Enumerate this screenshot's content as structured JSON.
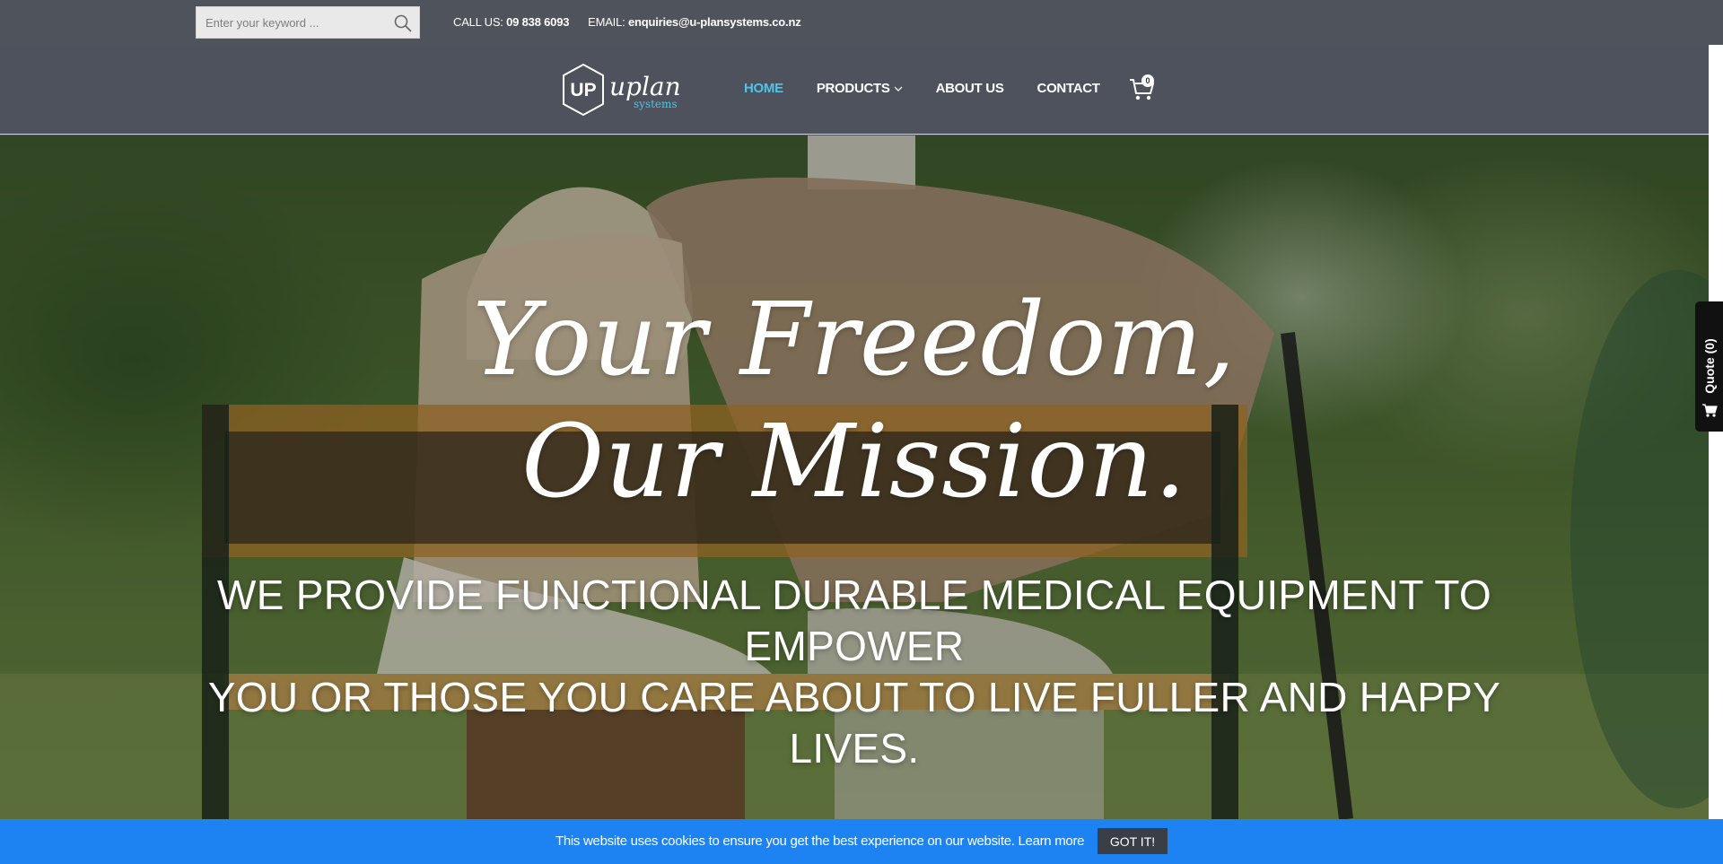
{
  "topbar": {
    "search_placeholder": "Enter your keyword ...",
    "call_label": "CALL US:",
    "phone": "09 838 6093",
    "email_label": "EMAIL:",
    "email": "enquiries@u-plansystems.co.nz"
  },
  "logo": {
    "mark": "UP",
    "name": "uplan",
    "tagline": "systems"
  },
  "nav": {
    "items": [
      {
        "label": "HOME",
        "active": true
      },
      {
        "label": "PRODUCTS",
        "has_dropdown": true
      },
      {
        "label": "ABOUT US"
      },
      {
        "label": "CONTACT"
      }
    ],
    "cart_count": "0"
  },
  "hero": {
    "title_line1": "Your Freedom,",
    "title_line2": "Our Mission.",
    "subtitle_line1": "We provide functional durable medical equipment to empower",
    "subtitle_line2": "you or those you care about to live fuller and happy lives."
  },
  "quote_tab": {
    "label": "Quote (0)"
  },
  "cookie": {
    "text": "This website uses cookies to ensure you get the best experience on our website.",
    "link": "Learn more",
    "button": "GOT IT!"
  },
  "colors": {
    "accent": "#4fc4e8",
    "header_bg": "#4d525c",
    "cookie_bg": "#1e83f2",
    "button_bg": "#3a3f47"
  }
}
